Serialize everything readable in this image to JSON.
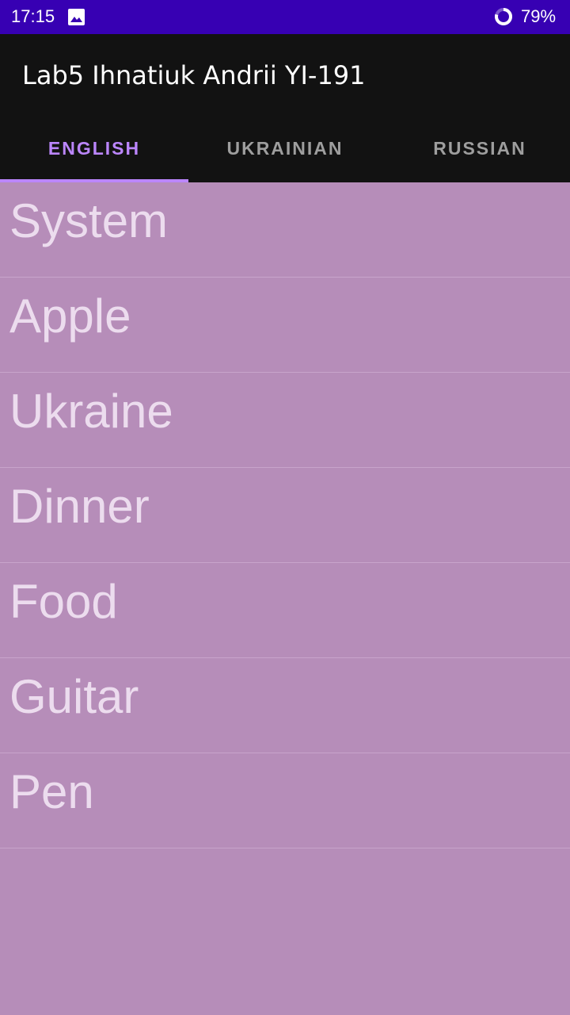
{
  "status_bar": {
    "time": "17:15",
    "battery_percent": "79%",
    "background": "#3700b3"
  },
  "app_bar": {
    "title": "Lab5 Ihnatiuk Andrii YI-191",
    "background": "#121212"
  },
  "tabs": [
    {
      "label": "ENGLISH",
      "active": true
    },
    {
      "label": "UKRAINIAN",
      "active": false
    },
    {
      "label": "RUSSIAN",
      "active": false
    }
  ],
  "accent_color": "#bb86fc",
  "list": {
    "background": "#b68db9",
    "items": [
      {
        "label": "System"
      },
      {
        "label": "Apple"
      },
      {
        "label": "Ukraine"
      },
      {
        "label": "Dinner"
      },
      {
        "label": "Food"
      },
      {
        "label": "Guitar"
      },
      {
        "label": "Pen"
      }
    ]
  }
}
